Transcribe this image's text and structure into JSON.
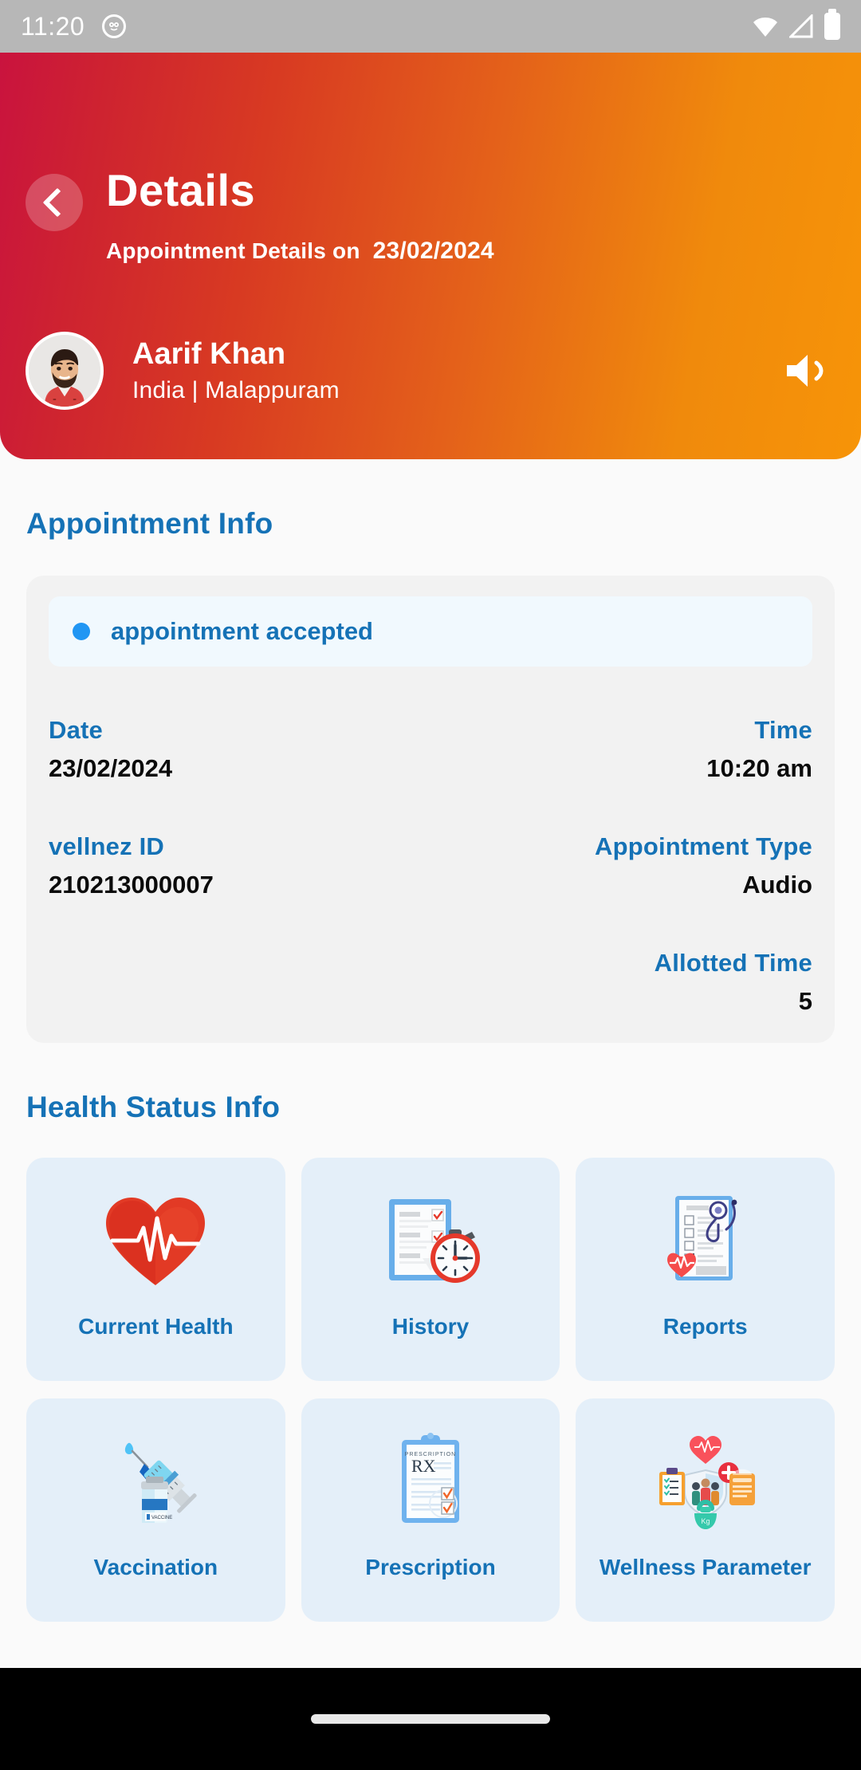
{
  "status_bar": {
    "time": "11:20",
    "app_icon": "owl-app-icon",
    "icons": [
      "wifi-icon",
      "cellular-signal-icon",
      "battery-icon"
    ]
  },
  "header": {
    "back_icon": "chevron-left-icon",
    "title": "Details",
    "subtitle_prefix": "Appointment Details on",
    "subtitle_date": "23/02/2024",
    "gradient_start": "#C9133E",
    "gradient_end": "#F79408",
    "patient": {
      "avatar": "patient-avatar-photo",
      "name": "Aarif Khan",
      "location": "India | Malappuram"
    },
    "speaker_icon": "volume-speaker-icon"
  },
  "appointment_info": {
    "section_title": "Appointment Info",
    "status": {
      "dot_color": "#2196F3",
      "label": "appointment accepted"
    },
    "rows": [
      {
        "left_label": "Date",
        "left_value": "23/02/2024",
        "right_label": "Time",
        "right_value": "10:20 am"
      },
      {
        "left_label": "vellnez ID",
        "left_value": "210213000007",
        "right_label": "Appointment Type",
        "right_value": "Audio"
      },
      {
        "left_label": "",
        "left_value": "",
        "right_label": "Allotted Time",
        "right_value": "5"
      }
    ]
  },
  "health_status_info": {
    "section_title": "Health Status Info",
    "tiles": [
      {
        "label": "Current Health",
        "icon": "heart-pulse-icon"
      },
      {
        "label": "History",
        "icon": "clipboard-stopwatch-icon"
      },
      {
        "label": "Reports",
        "icon": "medical-report-stethoscope-icon"
      },
      {
        "label": "Vaccination",
        "icon": "syringe-vial-icon"
      },
      {
        "label": "Prescription",
        "icon": "prescription-rx-clipboard-icon"
      },
      {
        "label": "Wellness Parameter",
        "icon": "wellness-composite-icon"
      }
    ],
    "card_background": "#E4EFF9",
    "label_color": "#1572B6"
  },
  "nav_bar": {
    "home_indicator": "home-indicator-pill"
  }
}
